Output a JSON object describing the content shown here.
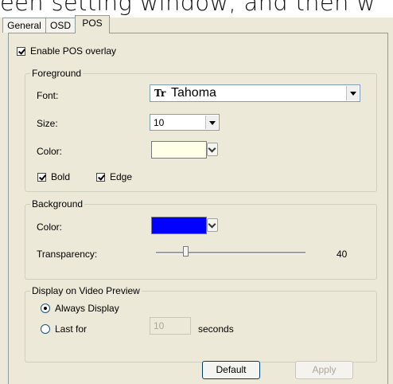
{
  "background_text": "een setting window, and then w",
  "tabs": [
    "General",
    "OSD",
    "POS"
  ],
  "enable_pos_overlay": {
    "label": "Enable POS overlay",
    "checked": true
  },
  "foreground": {
    "legend": "Foreground",
    "font_label": "Font:",
    "font_icon": "Tr",
    "font_value": "Tahoma",
    "size_label": "Size:",
    "size_value": "10",
    "color_label": "Color:",
    "color": "#ffffe8",
    "bold": {
      "label": "Bold",
      "checked": true
    },
    "edge": {
      "label": "Edge",
      "checked": true
    }
  },
  "background": {
    "legend": "Background",
    "color_label": "Color:",
    "color": "#0000ff",
    "transparency_label": "Transparency:",
    "transparency_value": "40",
    "transparency_level": 0.2
  },
  "display": {
    "legend": "Display on Video Preview",
    "always_label": "Always Display",
    "lastfor_label": "Last for",
    "seconds_value": "10",
    "seconds_label": "seconds",
    "selected": "always"
  },
  "buttons": {
    "default": "Default",
    "apply": "Apply"
  }
}
